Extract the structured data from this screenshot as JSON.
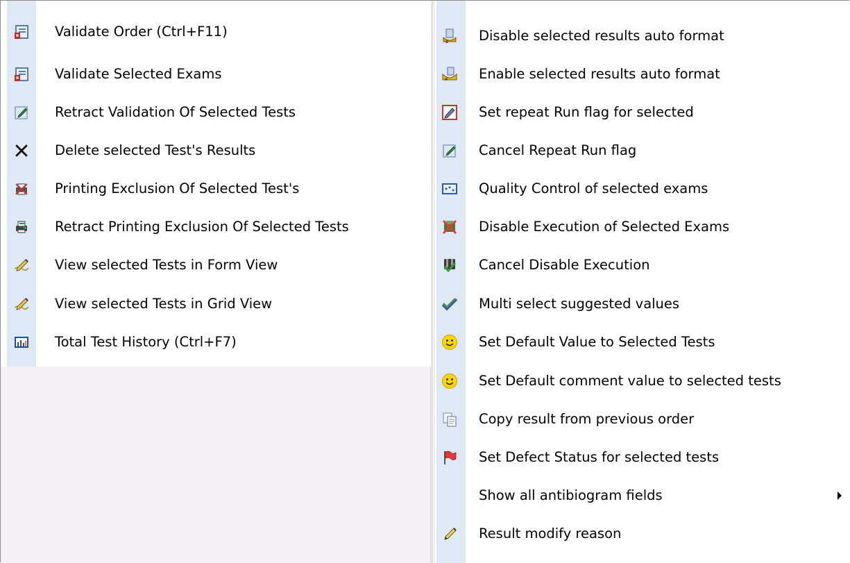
{
  "left_menu": {
    "items": [
      {
        "label": "Validate Order (Ctrl+F11)",
        "icon": "validate-doc-icon"
      },
      {
        "label": "Validate Selected Exams",
        "icon": "validate-doc-icon"
      },
      {
        "label": "Retract Validation Of Selected Tests",
        "icon": "edit-note-icon"
      },
      {
        "label": "Delete selected Test's Results",
        "icon": "delete-x-icon"
      },
      {
        "label": "Printing Exclusion Of Selected Test's",
        "icon": "printer-exclude-icon"
      },
      {
        "label": "Retract Printing Exclusion Of Selected Tests",
        "icon": "printer-include-icon"
      },
      {
        "label": "View selected Tests in Form View",
        "icon": "pencil-paper-icon"
      },
      {
        "label": "View selected Tests in Grid View",
        "icon": "pencil-paper-icon"
      },
      {
        "label": "Total Test History (Ctrl+F7)",
        "icon": "bar-chart-icon"
      }
    ]
  },
  "right_menu": {
    "items": [
      {
        "label": "Disable selected results auto format",
        "icon": "format-disable-icon"
      },
      {
        "label": "Enable selected results auto format",
        "icon": "format-enable-icon"
      },
      {
        "label": "Set repeat Run flag for selected",
        "icon": "edit-flag-icon"
      },
      {
        "label": "Cancel Repeat Run flag",
        "icon": "edit-note-icon"
      },
      {
        "label": "Quality Control of selected exams",
        "icon": "quality-control-icon"
      },
      {
        "label": "Disable Execution of Selected Exams",
        "icon": "disable-execution-icon"
      },
      {
        "label": "Cancel Disable Execution",
        "icon": "cancel-disable-icon"
      },
      {
        "label": "Multi select suggested values",
        "icon": "multi-check-icon"
      },
      {
        "label": "Set Default Value to Selected Tests",
        "icon": "smiley-icon"
      },
      {
        "label": "Set Default comment value to selected tests",
        "icon": "smiley-icon"
      },
      {
        "label": "Copy result from previous order",
        "icon": "copy-doc-icon"
      },
      {
        "label": "Set Defect Status for selected tests",
        "icon": "red-flag-icon"
      },
      {
        "label": "Show all antibiogram fields",
        "icon": "",
        "submenu": true
      },
      {
        "label": "Result modify reason",
        "icon": "pencil-paper-icon"
      }
    ]
  }
}
